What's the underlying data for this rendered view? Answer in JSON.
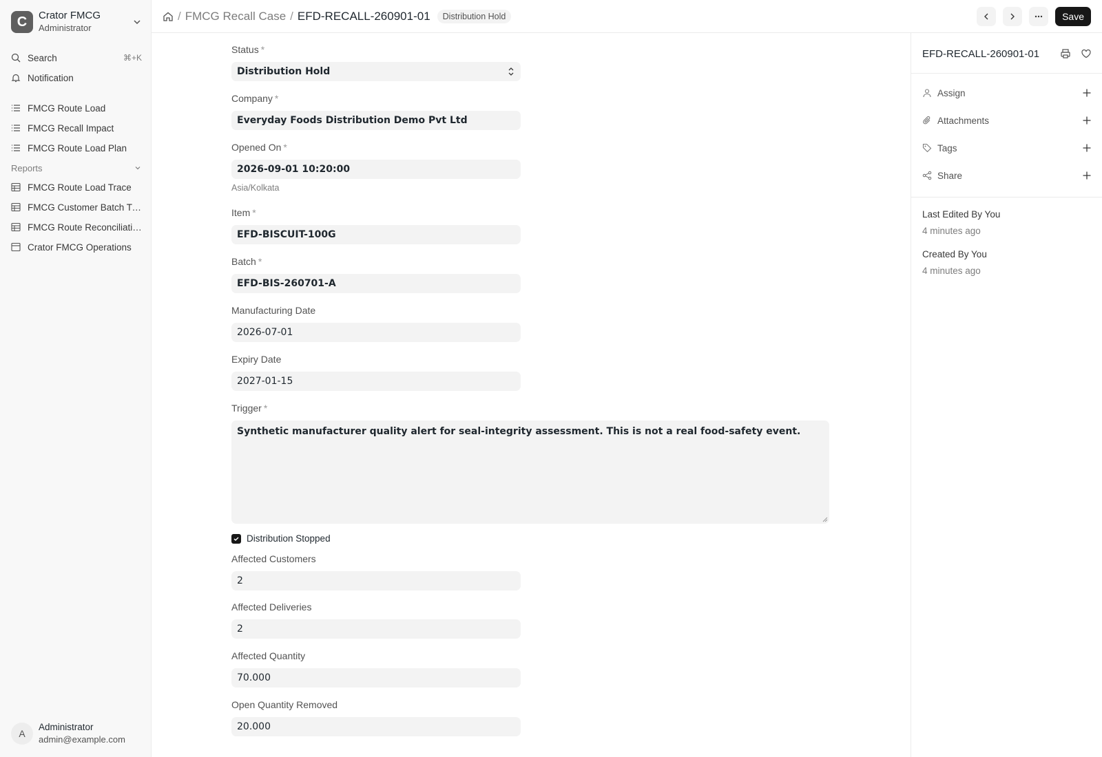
{
  "sidebar": {
    "workspace": {
      "initial": "C",
      "name": "Crator FMCG",
      "role": "Administrator"
    },
    "search": {
      "label": "Search",
      "shortcut": "⌘+K"
    },
    "notification": {
      "label": "Notification"
    },
    "items": [
      {
        "label": "FMCG Route Load",
        "icon": "list-icon"
      },
      {
        "label": "FMCG Recall Impact",
        "icon": "list-icon"
      },
      {
        "label": "FMCG Route Load Plan",
        "icon": "list-icon"
      }
    ],
    "reports_label": "Reports",
    "reports": [
      {
        "label": "FMCG Route Load Trace",
        "icon": "table-icon"
      },
      {
        "label": "FMCG Customer Batch Trace",
        "icon": "table-icon"
      },
      {
        "label": "FMCG Route Reconciliation",
        "icon": "table-icon"
      },
      {
        "label": "Crator FMCG Operations",
        "icon": "dashboard-icon"
      }
    ],
    "user": {
      "initial": "A",
      "name": "Administrator",
      "email": "admin@example.com"
    }
  },
  "header": {
    "breadcrumb_parent": "FMCG Recall Case",
    "breadcrumb_current": "EFD-RECALL-260901-01",
    "status_badge": "Distribution Hold",
    "save_label": "Save"
  },
  "form": {
    "status": {
      "label": "Status",
      "value": "Distribution Hold"
    },
    "company": {
      "label": "Company",
      "value": "Everyday Foods Distribution Demo Pvt Ltd"
    },
    "opened_on": {
      "label": "Opened On",
      "value": "2026-09-01 10:20:00",
      "timezone": "Asia/Kolkata"
    },
    "item": {
      "label": "Item",
      "value": "EFD-BISCUIT-100G"
    },
    "batch": {
      "label": "Batch",
      "value": "EFD-BIS-260701-A"
    },
    "manufacturing_date": {
      "label": "Manufacturing Date",
      "value": "2026-07-01"
    },
    "expiry_date": {
      "label": "Expiry Date",
      "value": "2027-01-15"
    },
    "trigger": {
      "label": "Trigger",
      "value": "Synthetic manufacturer quality alert for seal-integrity assessment. This is not a real food-safety event."
    },
    "distribution_stopped": {
      "label": "Distribution Stopped",
      "checked": true
    },
    "affected_customers": {
      "label": "Affected Customers",
      "value": "2"
    },
    "affected_deliveries": {
      "label": "Affected Deliveries",
      "value": "2"
    },
    "affected_quantity": {
      "label": "Affected Quantity",
      "value": "70.000"
    },
    "open_quantity_removed": {
      "label": "Open Quantity Removed",
      "value": "20.000"
    }
  },
  "right_panel": {
    "title": "EFD-RECALL-260901-01",
    "actions": [
      {
        "label": "Assign",
        "icon": "user-icon"
      },
      {
        "label": "Attachments",
        "icon": "paperclip-icon"
      },
      {
        "label": "Tags",
        "icon": "tag-icon"
      },
      {
        "label": "Share",
        "icon": "share-icon"
      }
    ],
    "last_edited": {
      "label": "Last Edited By You",
      "time": "4 minutes ago"
    },
    "created": {
      "label": "Created By You",
      "time": "4 minutes ago"
    }
  },
  "colors": {
    "accent": "#171717",
    "input_bg": "#f3f3f3",
    "sidebar_bg": "#f8f8f8"
  }
}
